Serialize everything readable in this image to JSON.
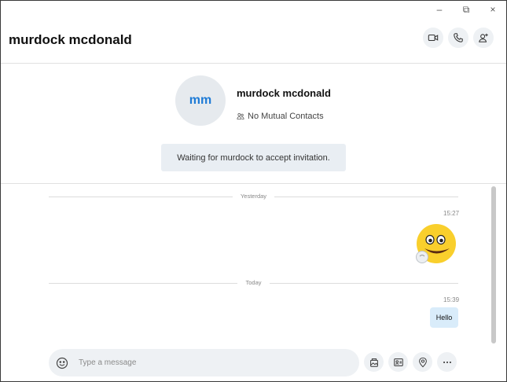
{
  "window": {
    "minimize": "–",
    "maximize": "⧉",
    "close": "×"
  },
  "header": {
    "title": "murdock mcdonald"
  },
  "contact": {
    "initials": "mm",
    "name": "murdock mcdonald",
    "mutual": "No Mutual Contacts",
    "invite_status": "Waiting for murdock to accept invitation."
  },
  "messages": {
    "yesterday_label": "Yesterday",
    "emoji_time": "15:27",
    "today_label": "Today",
    "hello_time": "15:39",
    "hello_text": "Hello"
  },
  "composer": {
    "placeholder": "Type a message"
  },
  "icons": {
    "video": "video-call-icon",
    "call": "phone-icon",
    "add_person": "add-person-icon",
    "emoji": "emoji-icon",
    "media": "media-gallery-icon",
    "contact_card": "contact-card-icon",
    "location": "location-pin-icon",
    "more": "more-icon"
  },
  "colors": {
    "accent": "#1e7bd6",
    "bubble": "#d9ecfa",
    "button_bg": "#eef1f4"
  }
}
